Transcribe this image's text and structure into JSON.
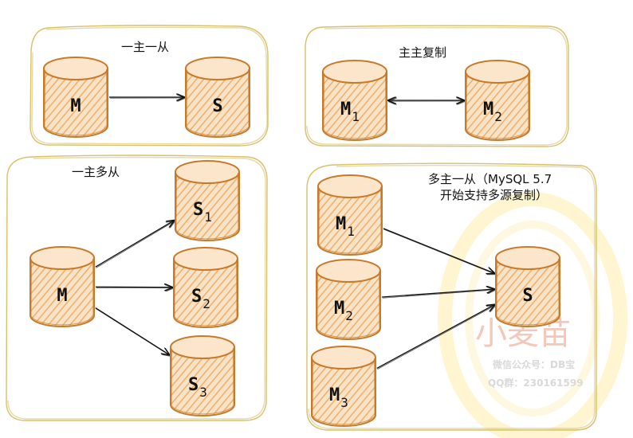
{
  "panels": [
    {
      "id": "one-master-one-slave",
      "caption": [
        "一主一从"
      ]
    },
    {
      "id": "master-master",
      "caption": [
        "主主复制"
      ]
    },
    {
      "id": "one-master-multi-slave",
      "caption": [
        "一主多从"
      ]
    },
    {
      "id": "multi-master-one-slave",
      "caption": [
        "多主一从（MySQL 5.7",
        "开始支持多源复制）"
      ]
    }
  ],
  "nodes": [
    {
      "id": "p1-m",
      "label": "M",
      "sub": ""
    },
    {
      "id": "p1-s",
      "label": "S",
      "sub": ""
    },
    {
      "id": "p2-m1",
      "label": "M",
      "sub": "1"
    },
    {
      "id": "p2-m2",
      "label": "M",
      "sub": "2"
    },
    {
      "id": "p3-m",
      "label": "M",
      "sub": ""
    },
    {
      "id": "p3-s1",
      "label": "S",
      "sub": "1"
    },
    {
      "id": "p3-s2",
      "label": "S",
      "sub": "2"
    },
    {
      "id": "p3-s3",
      "label": "S",
      "sub": "3"
    },
    {
      "id": "p4-m1",
      "label": "M",
      "sub": "1"
    },
    {
      "id": "p4-m2",
      "label": "M",
      "sub": "2"
    },
    {
      "id": "p4-m3",
      "label": "M",
      "sub": "3"
    },
    {
      "id": "p4-s",
      "label": "S",
      "sub": ""
    }
  ],
  "edges": [
    {
      "from": "p1-m",
      "to": "p1-s",
      "bidirectional": false
    },
    {
      "from": "p2-m1",
      "to": "p2-m2",
      "bidirectional": true
    },
    {
      "from": "p3-m",
      "to": "p3-s1",
      "bidirectional": false
    },
    {
      "from": "p3-m",
      "to": "p3-s2",
      "bidirectional": false
    },
    {
      "from": "p3-m",
      "to": "p3-s3",
      "bidirectional": false
    },
    {
      "from": "p4-m1",
      "to": "p4-s",
      "bidirectional": false
    },
    {
      "from": "p4-m2",
      "to": "p4-s",
      "bidirectional": false
    },
    {
      "from": "p4-m3",
      "to": "p4-s",
      "bidirectional": false
    }
  ],
  "watermark": {
    "title": "小麦苗",
    "line1": "微信公众号：DB宝",
    "line2": "QQ群：230161599"
  },
  "colors": {
    "panel_border": "#d9c06a",
    "cylinder_stroke": "#c87a2a",
    "cylinder_fill": "#f6d2a6",
    "hatch": "#eeae6c",
    "arrow": "#111111"
  }
}
